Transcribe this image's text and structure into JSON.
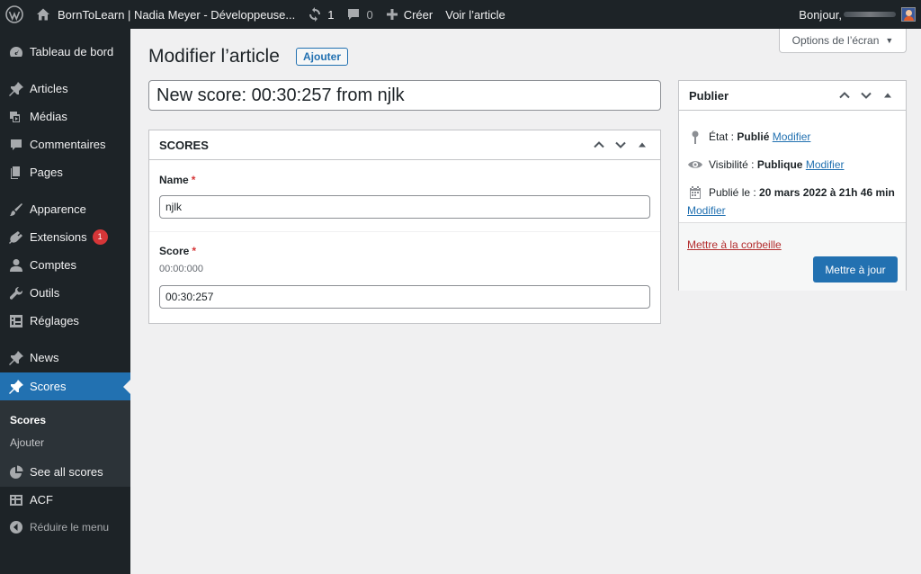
{
  "adminbar": {
    "site_name": "BornToLearn | Nadia Meyer - Développeuse...",
    "updates_count": "1",
    "comments_count": "0",
    "new_label": "Créer",
    "view_label": "Voir l’article",
    "greeting": "Bonjour,"
  },
  "sidebar": {
    "items": [
      {
        "label": "Tableau de bord",
        "icon": "dashboard-icon"
      },
      {
        "label": "Articles",
        "icon": "pin-icon"
      },
      {
        "label": "Médias",
        "icon": "media-icon"
      },
      {
        "label": "Commentaires",
        "icon": "comment-icon"
      },
      {
        "label": "Pages",
        "icon": "pages-icon"
      },
      {
        "label": "Apparence",
        "icon": "brush-icon"
      },
      {
        "label": "Extensions",
        "icon": "plugin-icon",
        "badge": "1"
      },
      {
        "label": "Comptes",
        "icon": "user-icon"
      },
      {
        "label": "Outils",
        "icon": "wrench-icon"
      },
      {
        "label": "Réglages",
        "icon": "settings-icon"
      },
      {
        "label": "News",
        "icon": "pin-icon"
      },
      {
        "label": "Scores",
        "icon": "pin-icon"
      },
      {
        "label": "See all scores",
        "icon": "chart-pie-icon"
      },
      {
        "label": "ACF",
        "icon": "grid-icon"
      }
    ],
    "submenu": [
      "Scores",
      "Ajouter"
    ],
    "collapse_label": "Réduire le menu"
  },
  "screen_options": {
    "label": "Options de l’écran"
  },
  "page": {
    "title": "Modifier l’article",
    "add_new": "Ajouter",
    "post_title": "New score: 00:30:257 from njlk"
  },
  "scores_box": {
    "title": "SCORES",
    "fields": {
      "name": {
        "label": "Name",
        "required": "*",
        "value": "njlk"
      },
      "score": {
        "label": "Score",
        "required": "*",
        "description": "00:00:000",
        "value": "00:30:257"
      }
    }
  },
  "publish_box": {
    "title": "Publier",
    "status_label": "État :",
    "status_value": "Publié",
    "visibility_label": "Visibilité :",
    "visibility_value": "Publique",
    "published_label": "Publié le :",
    "published_value": "20 mars 2022 à 21h 46 min",
    "edit_link": "Modifier",
    "trash_label": "Mettre à la corbeille",
    "update_label": "Mettre à jour"
  },
  "colors": {
    "accent": "#2271b1",
    "adminbar": "#1d2327",
    "badge": "#d63638"
  }
}
